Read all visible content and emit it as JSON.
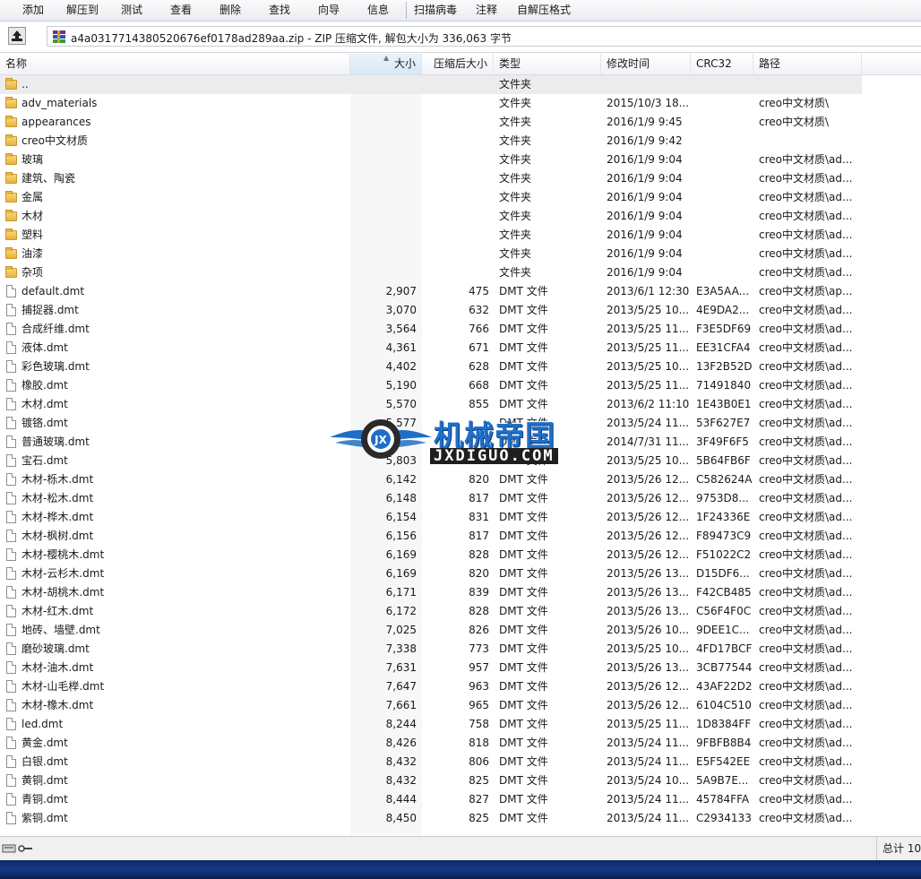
{
  "toolbar": {
    "buttons": [
      "添加",
      "解压到",
      "测试",
      "查看",
      "删除",
      "查找",
      "向导",
      "信息",
      "扫描病毒",
      "注释",
      "自解压格式"
    ]
  },
  "address": {
    "text": "a4a0317714380520676ef0178ad289aa.zip - ZIP 压缩文件, 解包大小为 336,063 字节"
  },
  "columns": {
    "name": "名称",
    "size": "大小",
    "compressed": "压缩后大小",
    "type": "类型",
    "modified": "修改时间",
    "crc": "CRC32",
    "path": "路径"
  },
  "rows": [
    {
      "name": "..",
      "size": "",
      "comp": "",
      "type": "文件夹",
      "mod": "",
      "crc": "",
      "path": "",
      "kind": "folder"
    },
    {
      "name": "adv_materials",
      "size": "",
      "comp": "",
      "type": "文件夹",
      "mod": "2015/10/3 18...",
      "crc": "",
      "path": "creo中文材质\\",
      "kind": "folder"
    },
    {
      "name": "appearances",
      "size": "",
      "comp": "",
      "type": "文件夹",
      "mod": "2016/1/9 9:45",
      "crc": "",
      "path": "creo中文材质\\",
      "kind": "folder"
    },
    {
      "name": "creo中文材质",
      "size": "",
      "comp": "",
      "type": "文件夹",
      "mod": "2016/1/9 9:42",
      "crc": "",
      "path": "",
      "kind": "folder"
    },
    {
      "name": "玻璃",
      "size": "",
      "comp": "",
      "type": "文件夹",
      "mod": "2016/1/9 9:04",
      "crc": "",
      "path": "creo中文材质\\ad...",
      "kind": "folder"
    },
    {
      "name": "建筑、陶瓷",
      "size": "",
      "comp": "",
      "type": "文件夹",
      "mod": "2016/1/9 9:04",
      "crc": "",
      "path": "creo中文材质\\ad...",
      "kind": "folder"
    },
    {
      "name": "金属",
      "size": "",
      "comp": "",
      "type": "文件夹",
      "mod": "2016/1/9 9:04",
      "crc": "",
      "path": "creo中文材质\\ad...",
      "kind": "folder"
    },
    {
      "name": "木材",
      "size": "",
      "comp": "",
      "type": "文件夹",
      "mod": "2016/1/9 9:04",
      "crc": "",
      "path": "creo中文材质\\ad...",
      "kind": "folder"
    },
    {
      "name": "塑料",
      "size": "",
      "comp": "",
      "type": "文件夹",
      "mod": "2016/1/9 9:04",
      "crc": "",
      "path": "creo中文材质\\ad...",
      "kind": "folder"
    },
    {
      "name": "油漆",
      "size": "",
      "comp": "",
      "type": "文件夹",
      "mod": "2016/1/9 9:04",
      "crc": "",
      "path": "creo中文材质\\ad...",
      "kind": "folder"
    },
    {
      "name": "杂项",
      "size": "",
      "comp": "",
      "type": "文件夹",
      "mod": "2016/1/9 9:04",
      "crc": "",
      "path": "creo中文材质\\ad...",
      "kind": "folder"
    },
    {
      "name": "default.dmt",
      "size": "2,907",
      "comp": "475",
      "type": "DMT 文件",
      "mod": "2013/6/1 12:30",
      "crc": "E3A5AA...",
      "path": "creo中文材质\\ap...",
      "kind": "file"
    },
    {
      "name": "捕捉器.dmt",
      "size": "3,070",
      "comp": "632",
      "type": "DMT 文件",
      "mod": "2013/5/25 10...",
      "crc": "4E9DA2...",
      "path": "creo中文材质\\ad...",
      "kind": "file"
    },
    {
      "name": "合成纤维.dmt",
      "size": "3,564",
      "comp": "766",
      "type": "DMT 文件",
      "mod": "2013/5/25 11...",
      "crc": "F3E5DF69",
      "path": "creo中文材质\\ad...",
      "kind": "file"
    },
    {
      "name": "液体.dmt",
      "size": "4,361",
      "comp": "671",
      "type": "DMT 文件",
      "mod": "2013/5/25 11...",
      "crc": "EE31CFA4",
      "path": "creo中文材质\\ad...",
      "kind": "file"
    },
    {
      "name": "彩色玻璃.dmt",
      "size": "4,402",
      "comp": "628",
      "type": "DMT 文件",
      "mod": "2013/5/25 10...",
      "crc": "13F2B52D",
      "path": "creo中文材质\\ad...",
      "kind": "file"
    },
    {
      "name": "橡胶.dmt",
      "size": "5,190",
      "comp": "668",
      "type": "DMT 文件",
      "mod": "2013/5/25 11...",
      "crc": "71491840",
      "path": "creo中文材质\\ad...",
      "kind": "file"
    },
    {
      "name": "木材.dmt",
      "size": "5,570",
      "comp": "855",
      "type": "DMT 文件",
      "mod": "2013/6/2 11:10",
      "crc": "1E43B0E1",
      "path": "creo中文材质\\ad...",
      "kind": "file"
    },
    {
      "name": "镀铬.dmt",
      "size": "5,577",
      "comp": "",
      "type": "DMT 文件",
      "mod": "2013/5/24 11...",
      "crc": "53F627E7",
      "path": "creo中文材质\\ad...",
      "kind": "file"
    },
    {
      "name": "普通玻璃.dmt",
      "size": "",
      "comp": "",
      "type": "DMT 文件",
      "mod": "2014/7/31 11...",
      "crc": "3F49F6F5",
      "path": "creo中文材质\\ad...",
      "kind": "file"
    },
    {
      "name": "宝石.dmt",
      "size": "5,803",
      "comp": "",
      "type": "DMT 文件",
      "mod": "2013/5/25 10...",
      "crc": "5B64FB6F",
      "path": "creo中文材质\\ad...",
      "kind": "file"
    },
    {
      "name": "木材-栎木.dmt",
      "size": "6,142",
      "comp": "820",
      "type": "DMT 文件",
      "mod": "2013/5/26 12...",
      "crc": "C582624A",
      "path": "creo中文材质\\ad...",
      "kind": "file"
    },
    {
      "name": "木材-松木.dmt",
      "size": "6,148",
      "comp": "817",
      "type": "DMT 文件",
      "mod": "2013/5/26 12...",
      "crc": "9753D8...",
      "path": "creo中文材质\\ad...",
      "kind": "file"
    },
    {
      "name": "木材-桦木.dmt",
      "size": "6,154",
      "comp": "831",
      "type": "DMT 文件",
      "mod": "2013/5/26 12...",
      "crc": "1F24336E",
      "path": "creo中文材质\\ad...",
      "kind": "file"
    },
    {
      "name": "木材-枫树.dmt",
      "size": "6,156",
      "comp": "817",
      "type": "DMT 文件",
      "mod": "2013/5/26 12...",
      "crc": "F89473C9",
      "path": "creo中文材质\\ad...",
      "kind": "file"
    },
    {
      "name": "木材-樱桃木.dmt",
      "size": "6,169",
      "comp": "828",
      "type": "DMT 文件",
      "mod": "2013/5/26 12...",
      "crc": "F51022C2",
      "path": "creo中文材质\\ad...",
      "kind": "file"
    },
    {
      "name": "木材-云杉木.dmt",
      "size": "6,169",
      "comp": "820",
      "type": "DMT 文件",
      "mod": "2013/5/26 13...",
      "crc": "D15DF6...",
      "path": "creo中文材质\\ad...",
      "kind": "file"
    },
    {
      "name": "木材-胡桃木.dmt",
      "size": "6,171",
      "comp": "839",
      "type": "DMT 文件",
      "mod": "2013/5/26 13...",
      "crc": "F42CB485",
      "path": "creo中文材质\\ad...",
      "kind": "file"
    },
    {
      "name": "木材-红木.dmt",
      "size": "6,172",
      "comp": "828",
      "type": "DMT 文件",
      "mod": "2013/5/26 13...",
      "crc": "C56F4F0C",
      "path": "creo中文材质\\ad...",
      "kind": "file"
    },
    {
      "name": "地砖、墙壁.dmt",
      "size": "7,025",
      "comp": "826",
      "type": "DMT 文件",
      "mod": "2013/5/26 10...",
      "crc": "9DEE1C...",
      "path": "creo中文材质\\ad...",
      "kind": "file"
    },
    {
      "name": "磨砂玻璃.dmt",
      "size": "7,338",
      "comp": "773",
      "type": "DMT 文件",
      "mod": "2013/5/25 10...",
      "crc": "4FD17BCF",
      "path": "creo中文材质\\ad...",
      "kind": "file"
    },
    {
      "name": "木材-油木.dmt",
      "size": "7,631",
      "comp": "957",
      "type": "DMT 文件",
      "mod": "2013/5/26 13...",
      "crc": "3CB77544",
      "path": "creo中文材质\\ad...",
      "kind": "file"
    },
    {
      "name": "木材-山毛榉.dmt",
      "size": "7,647",
      "comp": "963",
      "type": "DMT 文件",
      "mod": "2013/5/26 12...",
      "crc": "43AF22D2",
      "path": "creo中文材质\\ad...",
      "kind": "file"
    },
    {
      "name": "木材-橡木.dmt",
      "size": "7,661",
      "comp": "965",
      "type": "DMT 文件",
      "mod": "2013/5/26 12...",
      "crc": "6104C510",
      "path": "creo中文材质\\ad...",
      "kind": "file"
    },
    {
      "name": "led.dmt",
      "size": "8,244",
      "comp": "758",
      "type": "DMT 文件",
      "mod": "2013/5/25 11...",
      "crc": "1D8384FF",
      "path": "creo中文材质\\ad...",
      "kind": "file"
    },
    {
      "name": "黄金.dmt",
      "size": "8,426",
      "comp": "818",
      "type": "DMT 文件",
      "mod": "2013/5/24 11...",
      "crc": "9FBFB8B4",
      "path": "creo中文材质\\ad...",
      "kind": "file"
    },
    {
      "name": "白银.dmt",
      "size": "8,432",
      "comp": "806",
      "type": "DMT 文件",
      "mod": "2013/5/24 11...",
      "crc": "E5F542EE",
      "path": "creo中文材质\\ad...",
      "kind": "file"
    },
    {
      "name": "黄铜.dmt",
      "size": "8,432",
      "comp": "825",
      "type": "DMT 文件",
      "mod": "2013/5/24 10...",
      "crc": "5A9B7E...",
      "path": "creo中文材质\\ad...",
      "kind": "file"
    },
    {
      "name": "青铜.dmt",
      "size": "8,444",
      "comp": "827",
      "type": "DMT 文件",
      "mod": "2013/5/24 11...",
      "crc": "45784FFA",
      "path": "creo中文材质\\ad...",
      "kind": "file"
    },
    {
      "name": "紫铜.dmt",
      "size": "8,450",
      "comp": "825",
      "type": "DMT 文件",
      "mod": "2013/5/24 11...",
      "crc": "C2934133",
      "path": "creo中文材质\\ad...",
      "kind": "file"
    }
  ],
  "status": {
    "right": "总计 10"
  },
  "watermark": {
    "title": "机械帝国",
    "subtitle": "JXDIGUO.COM"
  },
  "colors": {
    "header_sorted": "#d7e8f7",
    "parent_row": "#ececec",
    "taskbar": "#153a88",
    "watermark_blue": "#1f6fc8"
  }
}
